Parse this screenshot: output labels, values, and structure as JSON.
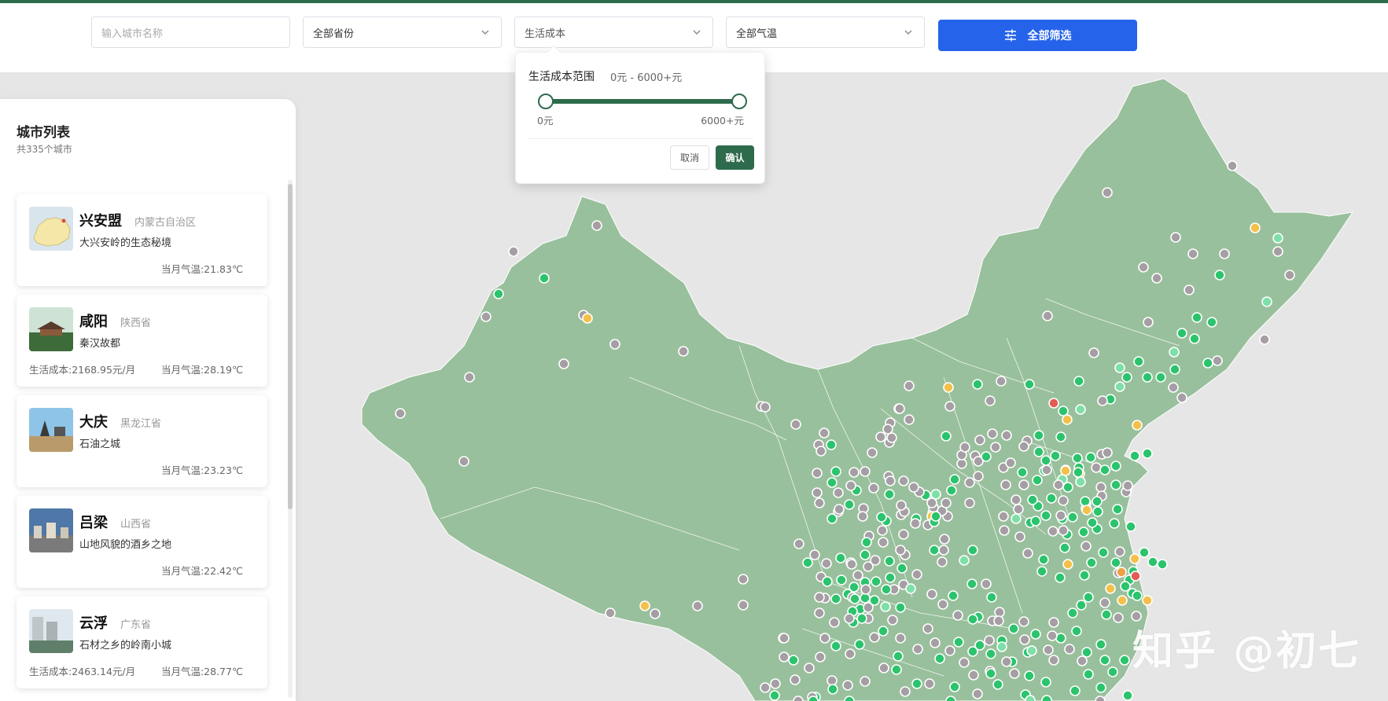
{
  "filters": {
    "city_placeholder": "输入城市名称",
    "province": "全部省份",
    "cost": "生活成本",
    "temperature": "全部气温",
    "filter_button": "全部筛选"
  },
  "cost_popover": {
    "title": "生活成本范围",
    "range_text": "0元 - 6000+元",
    "min_label": "0元",
    "max_label": "6000+元",
    "min_value": 0,
    "max_value": 1,
    "cancel": "取消",
    "confirm": "确认"
  },
  "city_list": {
    "title": "城市列表",
    "count": "共335个城市",
    "cities": [
      {
        "name": "兴安盟",
        "province": "内蒙古自治区",
        "desc": "大兴安岭的生态秘境",
        "cost": "",
        "temp": "当月气温:21.83℃"
      },
      {
        "name": "咸阳",
        "province": "陕西省",
        "desc": "秦汉故都",
        "cost": "生活成本:2168.95元/月",
        "temp": "当月气温:28.19℃"
      },
      {
        "name": "大庆",
        "province": "黑龙江省",
        "desc": "石油之城",
        "cost": "",
        "temp": "当月气温:23.23℃"
      },
      {
        "name": "吕梁",
        "province": "山西省",
        "desc": "山地风貌的酒乡之地",
        "cost": "",
        "temp": "当月气温:22.42℃"
      },
      {
        "name": "云浮",
        "province": "广东省",
        "desc": "石材之乡的岭南小城",
        "cost": "生活成本:2463.14元/月",
        "temp": "当月气温:28.77℃"
      }
    ]
  },
  "colors": {
    "accent": "#2e6b4c",
    "button": "#2563eb",
    "map_fill": "#99c09c",
    "dot_green": "#2bc46d",
    "dot_lightgreen": "#7ee0a8",
    "dot_gray": "#a59ea4",
    "dot_yellow": "#f5c04a",
    "dot_orange": "#f0a044",
    "dot_red": "#e45a55"
  },
  "watermark": "知乎 @初七"
}
